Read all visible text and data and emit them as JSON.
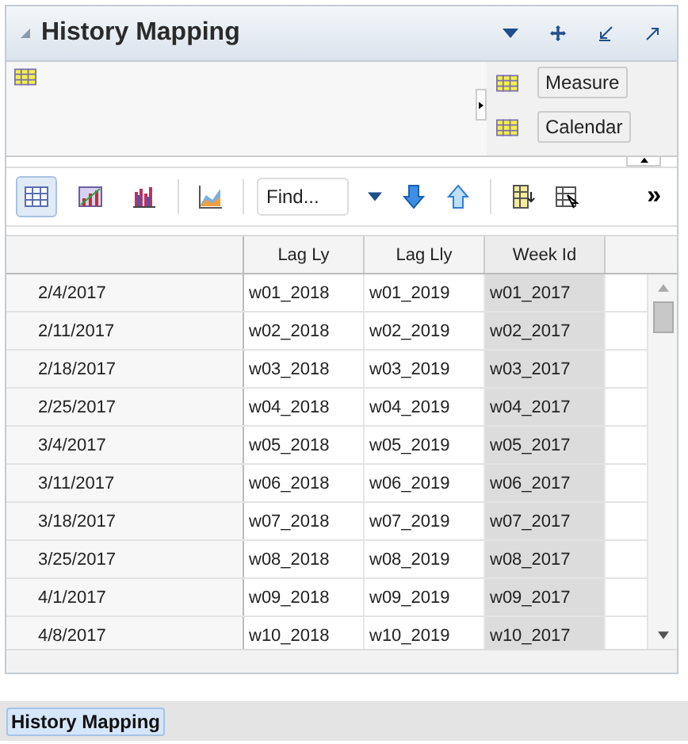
{
  "panel": {
    "title": "History Mapping"
  },
  "pivot": {
    "tiles": [
      {
        "label": "Measure"
      },
      {
        "label": "Calendar"
      }
    ]
  },
  "toolbar": {
    "views": [
      {
        "kind": "grid",
        "selected": true
      },
      {
        "kind": "chart",
        "selected": false
      },
      {
        "kind": "bars",
        "selected": false
      }
    ],
    "find": {
      "placeholder": "Find..."
    },
    "more": "»"
  },
  "table": {
    "columns": [
      "Lag Ly",
      "Lag Lly",
      "Week Id"
    ],
    "rows": [
      {
        "header": "2/4/2017",
        "cells": [
          "w01_2018",
          "w01_2019",
          "w01_2017"
        ]
      },
      {
        "header": "2/11/2017",
        "cells": [
          "w02_2018",
          "w02_2019",
          "w02_2017"
        ]
      },
      {
        "header": "2/18/2017",
        "cells": [
          "w03_2018",
          "w03_2019",
          "w03_2017"
        ]
      },
      {
        "header": "2/25/2017",
        "cells": [
          "w04_2018",
          "w04_2019",
          "w04_2017"
        ]
      },
      {
        "header": "3/4/2017",
        "cells": [
          "w05_2018",
          "w05_2019",
          "w05_2017"
        ]
      },
      {
        "header": "3/11/2017",
        "cells": [
          "w06_2018",
          "w06_2019",
          "w06_2017"
        ]
      },
      {
        "header": "3/18/2017",
        "cells": [
          "w07_2018",
          "w07_2019",
          "w07_2017"
        ]
      },
      {
        "header": "3/25/2017",
        "cells": [
          "w08_2018",
          "w08_2019",
          "w08_2017"
        ]
      },
      {
        "header": "4/1/2017",
        "cells": [
          "w09_2018",
          "w09_2019",
          "w09_2017"
        ]
      },
      {
        "header": "4/8/2017",
        "cells": [
          "w10_2018",
          "w10_2019",
          "w10_2017"
        ]
      }
    ]
  },
  "footer_tabs": [
    {
      "label": "History Mapping",
      "selected": true
    }
  ]
}
